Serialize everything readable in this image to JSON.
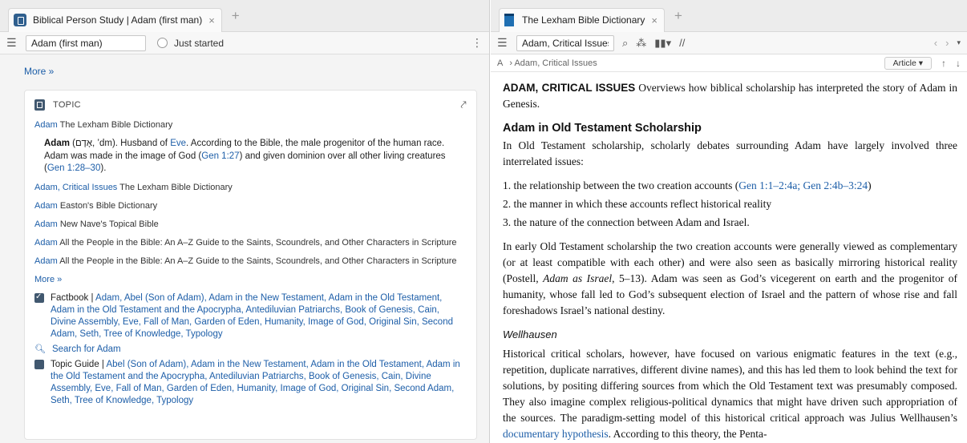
{
  "left": {
    "tab_title": "Biblical Person Study | Adam (first man)",
    "tab_close": "×",
    "tab_add": "+",
    "search_value": "Adam (first man)",
    "progress_label": "Just started",
    "more_top": "More »",
    "topic_header": "TOPIC",
    "first_entry_title": "Adam",
    "first_entry_source": "The Lexham Bible Dictionary",
    "entry_head": "Adam",
    "entry_body_1": " (אָדָם, ’dm). Husband of ",
    "entry_link_eve": "Eve",
    "entry_body_2": ". According to the Bible, the male progenitor of the human race. Adam was made in the image of God (",
    "entry_ref_1": "Gen 1:27",
    "entry_body_3": ") and given dominion over all other living creatures (",
    "entry_ref_2": "Gen 1:28–30",
    "entry_body_4": ").",
    "results": [
      {
        "title": "Adam, Critical Issues",
        "source": "The Lexham Bible Dictionary"
      },
      {
        "title": "Adam",
        "source": "Easton's Bible Dictionary"
      },
      {
        "title": "Adam",
        "source": "New Nave's Topical Bible"
      },
      {
        "title": "Adam",
        "source": "All the People in the Bible: An A–Z Guide to the Saints, Scoundrels, and Other Characters in Scripture"
      },
      {
        "title": "Adam",
        "source": "All the People in the Bible: An A–Z Guide to the Saints, Scoundrels, and Other Characters in Scripture"
      }
    ],
    "more_bottom": "More »",
    "factbook_prefix": "Factbook | ",
    "factbook_links": "Adam, Abel (Son of Adam), Adam in the New Testament, Adam in the Old Testament, Adam in the Old Testament and the Apocrypha, Antediluvian Patriarchs, Book of Genesis, Cain, Divine Assembly, Eve, Fall of Man, Garden of Eden, Humanity, Image of God, Original Sin, Second Adam, Seth, Tree of Knowledge, Typology",
    "search_for": "Search for Adam",
    "topic_guide_prefix": "Topic Guide | ",
    "topic_guide_links": "Abel (Son of Adam), Adam in the New Testament, Adam in the Old Testament, Adam in the Old Testament and the Apocrypha, Antediluvian Patriarchs, Book of Genesis, Cain, Divine Assembly, Eve, Fall of Man, Garden of Eden, Humanity, Image of God, Original Sin, Second Adam, Seth, Tree of Knowledge, Typology"
  },
  "right": {
    "tab_title": "The Lexham Bible Dictionary",
    "tab_close": "×",
    "tab_add": "+",
    "search_value": "Adam, Critical Issues",
    "crumb_a": "A",
    "crumb_path": "› Adam, Critical Issues",
    "article_btn": "Article ▾",
    "lead_title": "ADAM, CRITICAL ISSUES",
    "lead_text": " Overviews how biblical scholarship has interpreted the story of Adam in Genesis.",
    "h_ot": "Adam in Old Testament Scholarship",
    "p_ot": "In Old Testament scholarship, scholarly debates surrounding Adam have largely involved three interrelated issues:",
    "li1_a": "1. the relationship between the two creation accounts (",
    "li1_ref": "Gen 1:1–2:4a; Gen 2:4b–3:24",
    "li1_b": ")",
    "li2": "2. the manner in which these accounts reflect historical reality",
    "li3": "3. the nature of the connection between Adam and Israel.",
    "p_early_a": "In early Old Testament scholarship the two creation accounts were generally viewed as complementary (or at least compatible with each other) and were also seen as basically mirroring historical reality (Postell, ",
    "p_early_italic": "Adam as Israel",
    "p_early_b": ", 5–13). Adam was seen as God’s vicegerent on earth and the progenitor of humanity, whose fall led to God’s subsequent election of Israel and the pattern of whose rise and fall foreshadows Israel’s national destiny.",
    "h_well": "Wellhausen",
    "p_well_a": "Historical critical scholars, however, have focused on various enigmatic features in the text (e.g., repetition, duplicate narratives, different divine names), and this has led them to look behind the text for solutions, by positing differing sources from which the Old Testament text was presumably composed. They also imagine complex religious-political dynamics that might have driven such appropriation of the sources. The paradigm-setting model of this historical critical approach was Julius Wellhausen’s ",
    "p_well_link": "documentary hypothesis",
    "p_well_b": ". According to this theory, the Penta-"
  }
}
